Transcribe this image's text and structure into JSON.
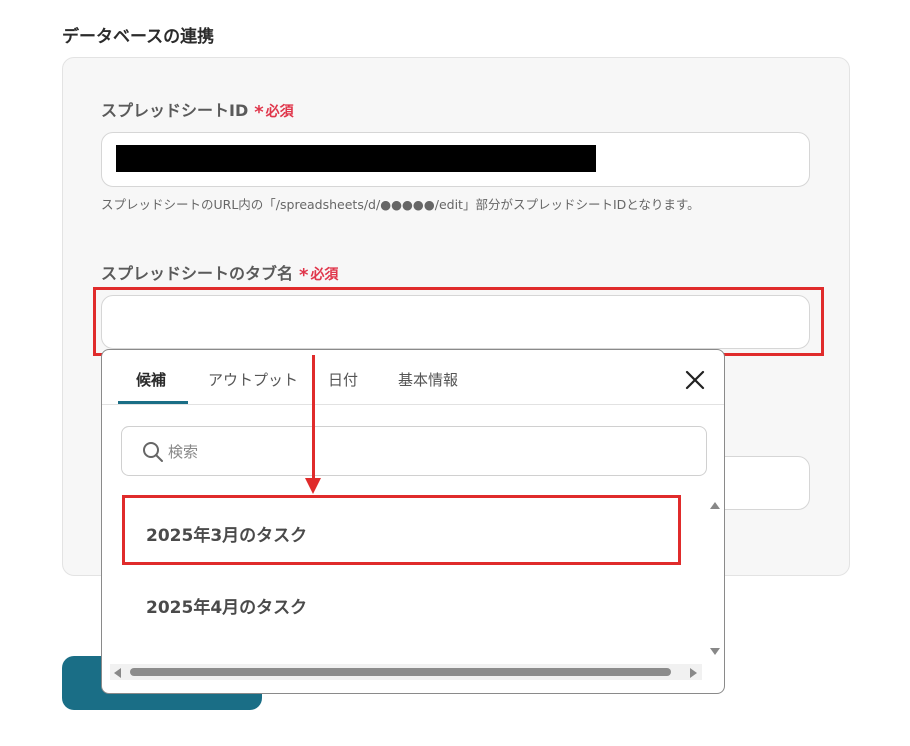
{
  "section": {
    "title": "データベースの連携"
  },
  "fields": {
    "spreadsheet_id": {
      "label": "スプレッドシートID",
      "required": "必須",
      "hint": "スプレッドシートのURL内の「/spreadsheets/d/●●●●●/edit」部分がスプレッドシートIDとなります。"
    },
    "tab_name": {
      "label": "スプレッドシートのタブ名",
      "required": "必須"
    }
  },
  "dropdown": {
    "tabs": [
      {
        "label": "候補",
        "active": true
      },
      {
        "label": "アウトプット",
        "active": false
      },
      {
        "label": "日付",
        "active": false
      },
      {
        "label": "基本情報",
        "active": false
      }
    ],
    "search": {
      "placeholder": "検索",
      "value": ""
    },
    "options": [
      {
        "label": "2025年3月のタスク",
        "highlighted": true
      },
      {
        "label": "2025年4月のタスク",
        "highlighted": false
      }
    ]
  },
  "icons": {
    "close": "close-icon",
    "search": "search-icon",
    "required_marker": "asterisk-icon"
  },
  "colors": {
    "accent": "#1a6e86",
    "required": "#e0364b",
    "highlight": "#e02b2b"
  }
}
